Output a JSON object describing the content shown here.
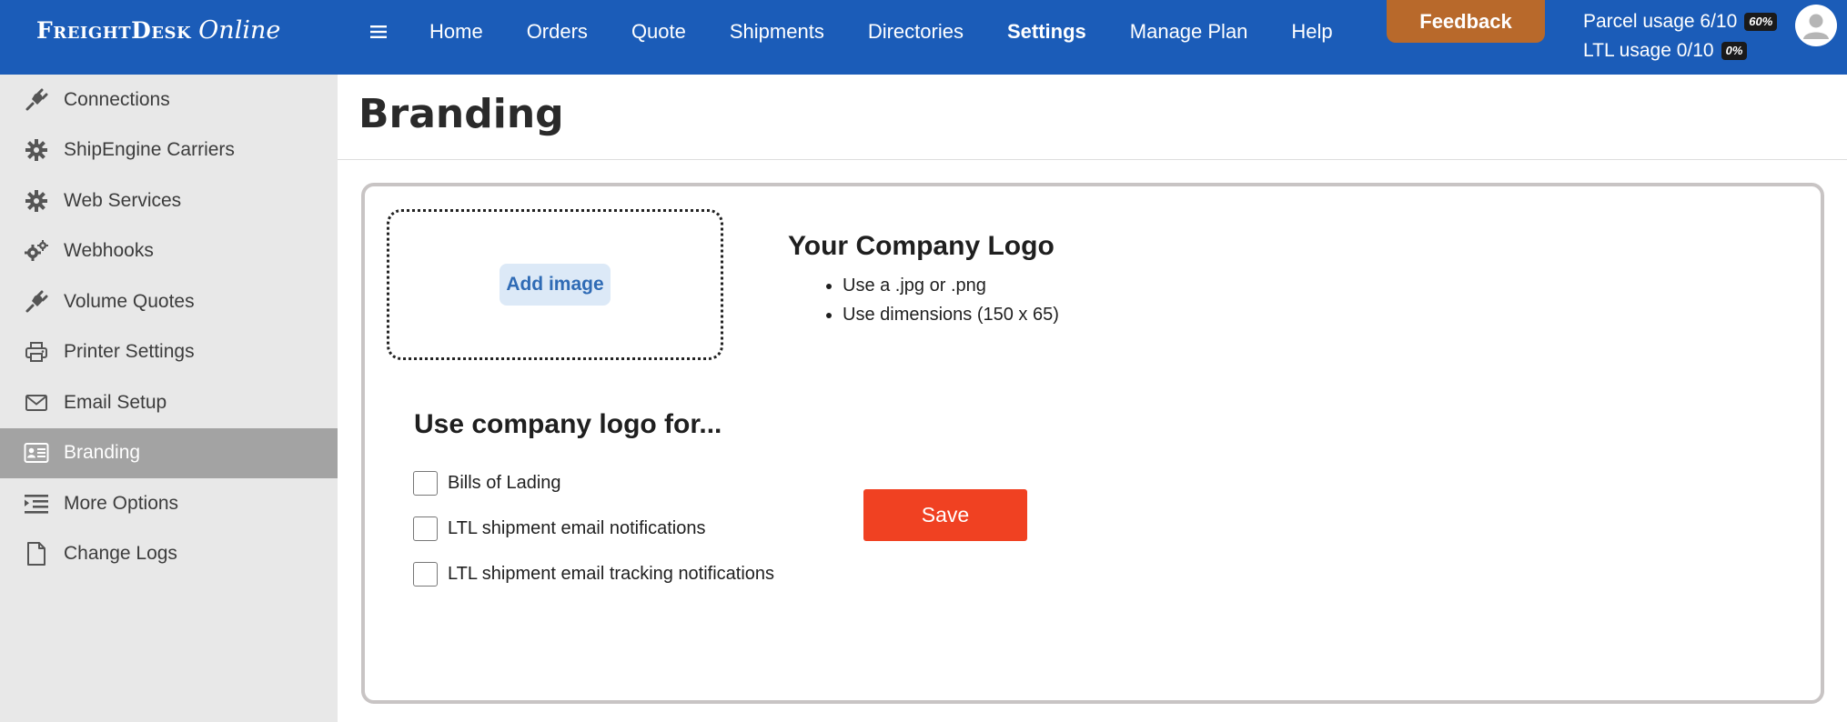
{
  "header": {
    "logo_main": "FreightDesk",
    "logo_sub": "Online",
    "nav": [
      {
        "label": "Home"
      },
      {
        "label": "Orders"
      },
      {
        "label": "Quote"
      },
      {
        "label": "Shipments"
      },
      {
        "label": "Directories"
      },
      {
        "label": "Settings",
        "active": true
      },
      {
        "label": "Manage Plan"
      },
      {
        "label": "Help"
      }
    ],
    "feedback_label": "Feedback",
    "usage": {
      "parcel_label": "Parcel usage 6/10",
      "parcel_pct": "60%",
      "ltl_label": "LTL usage 0/10",
      "ltl_pct": "0%"
    }
  },
  "sidebar": {
    "items": [
      {
        "label": "Connections",
        "icon": "plug-icon"
      },
      {
        "label": "ShipEngine Carriers",
        "icon": "gear-icon"
      },
      {
        "label": "Web Services",
        "icon": "gear-icon"
      },
      {
        "label": "Webhooks",
        "icon": "gears-icon"
      },
      {
        "label": "Volume Quotes",
        "icon": "plug-icon"
      },
      {
        "label": "Printer Settings",
        "icon": "printer-icon"
      },
      {
        "label": "Email Setup",
        "icon": "envelope-icon"
      },
      {
        "label": "Branding",
        "icon": "id-card-icon",
        "active": true
      },
      {
        "label": "More Options",
        "icon": "list-indent-icon"
      },
      {
        "label": "Change Logs",
        "icon": "file-icon"
      }
    ]
  },
  "main": {
    "page_title": "Branding",
    "add_image_label": "Add image",
    "logo_title": "Your Company Logo",
    "logo_tips": [
      "Use a .jpg or .png",
      "Use dimensions (150 x 65)"
    ],
    "use_title": "Use company logo for...",
    "options": [
      {
        "label": "Bills of Lading",
        "checked": false
      },
      {
        "label": "LTL shipment email notifications",
        "checked": false
      },
      {
        "label": "LTL shipment email tracking notifications",
        "checked": false
      }
    ],
    "save_label": "Save"
  },
  "colors": {
    "topbar": "#1b5cb8",
    "feedback": "#b8692b",
    "save": "#f04122",
    "sidebar_active": "#a3a3a3"
  }
}
